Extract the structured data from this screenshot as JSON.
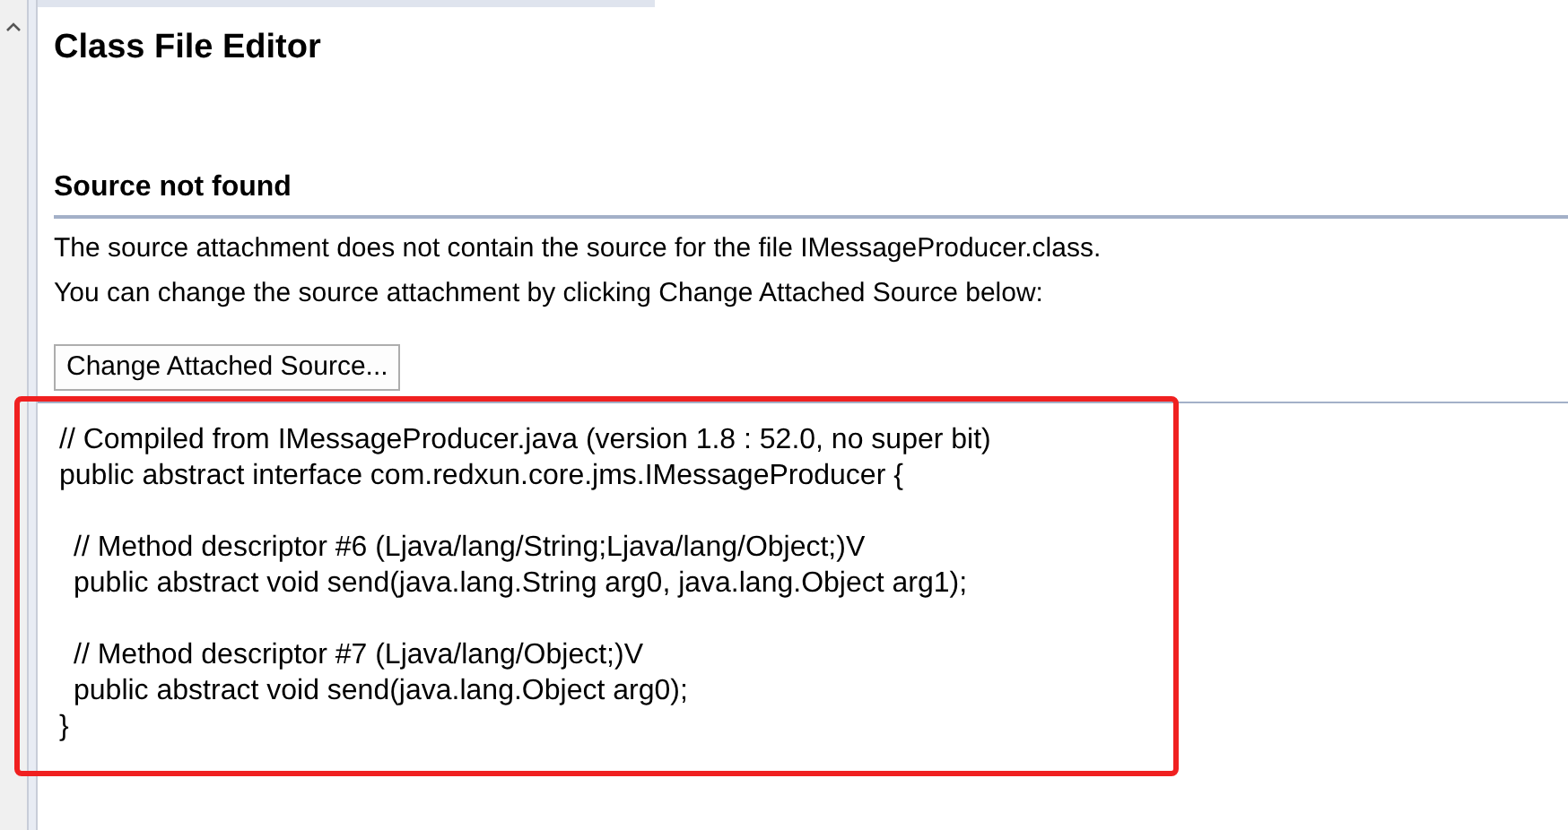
{
  "editor": {
    "title": "Class File Editor",
    "section_heading": "Source not found",
    "messages": [
      "The source attachment does not contain the source for the file IMessageProducer.class.",
      "You can change the source attachment by clicking Change Attached Source below:"
    ],
    "button": "Change Attached Source...",
    "code": {
      "highlighted": true,
      "blocks": [
        [
          {
            "text": "// Compiled from IMessageProducer.java (version 1.8 : 52.0, no super bit)",
            "indented": false
          },
          {
            "text": "public abstract interface com.redxun.core.jms.IMessageProducer {",
            "indented": false
          }
        ],
        [
          {
            "text": "// Method descriptor #6 (Ljava/lang/String;Ljava/lang/Object;)V",
            "indented": true
          },
          {
            "text": "public abstract void send(java.lang.String arg0, java.lang.Object arg1);",
            "indented": true
          }
        ],
        [
          {
            "text": "// Method descriptor #7 (Ljava/lang/Object;)V",
            "indented": true
          },
          {
            "text": "public abstract void send(java.lang.Object arg0);",
            "indented": true
          },
          {
            "text": "}",
            "indented": false
          }
        ]
      ]
    }
  }
}
